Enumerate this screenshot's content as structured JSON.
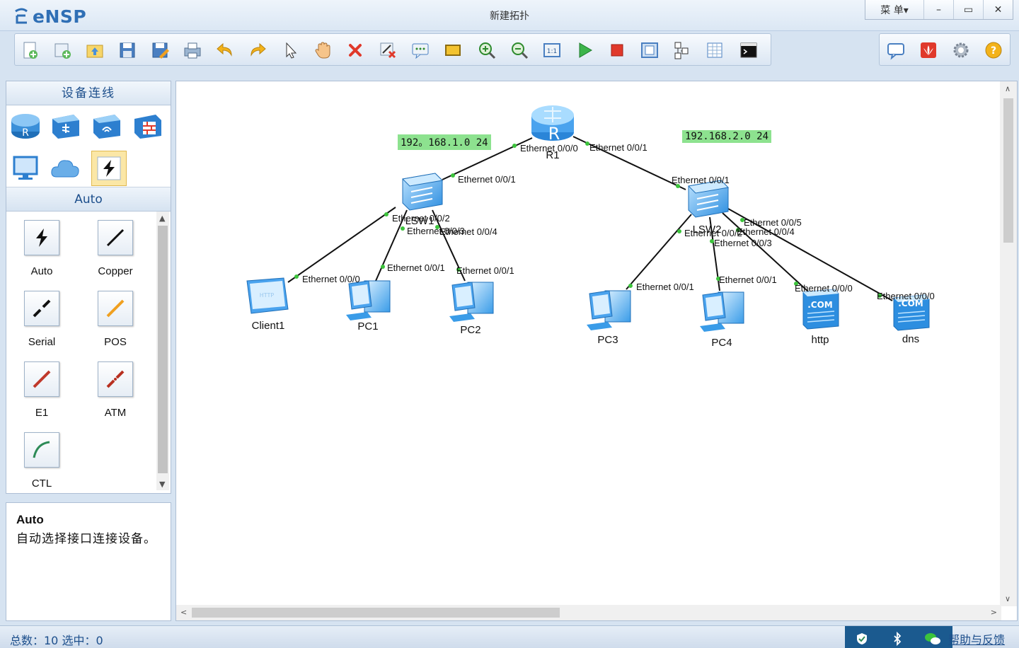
{
  "app": {
    "name": "eNSP",
    "window_title": "新建拓扑"
  },
  "window_controls": {
    "menu_label": "菜 单▾",
    "minimize": "–",
    "maximize": "▭",
    "close": "✕"
  },
  "toolbar": {
    "icons": [
      "new-topology-icon",
      "new-example-icon",
      "open-icon",
      "save-icon",
      "save-as-icon",
      "print-icon",
      "undo-icon",
      "redo-icon",
      "select-pointer-icon",
      "pan-hand-icon",
      "delete-icon",
      "delete-link-icon",
      "text-annotation-icon",
      "rectangle-icon",
      "zoom-in-icon",
      "zoom-out-icon",
      "fit-view-icon",
      "start-device-icon",
      "stop-device-icon",
      "capture-icon",
      "topology-icon",
      "grid-icon",
      "console-icon"
    ],
    "right_icons": [
      "chat-icon",
      "huawei-icon",
      "settings-gear-icon",
      "help-icon"
    ]
  },
  "left_panel": {
    "device_header": "设备连线",
    "devices": [
      "router-icon",
      "switch-icon",
      "wlan-icon",
      "firewall-icon",
      "pc-icon",
      "cloud-icon",
      "auto-link-icon"
    ],
    "cable_header": "Auto",
    "cables": [
      {
        "label": "Auto",
        "color": "#111111"
      },
      {
        "label": "Copper",
        "color": "#111111"
      },
      {
        "label": "Serial",
        "color": "#111111"
      },
      {
        "label": "POS",
        "color": "#f0a020"
      },
      {
        "label": "E1",
        "color": "#c0392b"
      },
      {
        "label": "ATM",
        "color": "#b83020"
      },
      {
        "label": "CTL",
        "color": "#2e8b57"
      }
    ]
  },
  "description": {
    "title": "Auto",
    "text": "自动选择接口连接设备。"
  },
  "topology": {
    "ip_labels": [
      "192。168.1.0 24",
      "192.168.2.0 24"
    ],
    "devices": [
      {
        "name": "R1",
        "type": "router"
      },
      {
        "name": "LSW1",
        "type": "switch"
      },
      {
        "name": "LSW2",
        "type": "switch"
      },
      {
        "name": "Client1",
        "type": "client"
      },
      {
        "name": "PC1",
        "type": "pc"
      },
      {
        "name": "PC2",
        "type": "pc"
      },
      {
        "name": "PC3",
        "type": "pc"
      },
      {
        "name": "PC4",
        "type": "pc"
      },
      {
        "name": "http",
        "type": "server"
      },
      {
        "name": "dns",
        "type": "server"
      }
    ],
    "port_labels": [
      "Ethernet 0/0/0",
      "Ethernet 0/0/1",
      "Ethernet 0/0/1",
      "Ethernet 0/0/1",
      "Ethernet 0/0/2",
      "Ethernet 0/0/3",
      "Ethernet 0/0/4",
      "Ethernet 0/0/0",
      "Ethernet 0/0/1",
      "Ethernet 0/0/1",
      "Ethernet 0/0/2",
      "Ethernet 0/0/5",
      "Ethernet 0/0/4",
      "Ethernet 0/0/3",
      "Ethernet 0/0/1",
      "Ethernet 0/0/1",
      "Ethernet 0/0/0",
      "Ethernet 0/0/0"
    ]
  },
  "status": {
    "text": "总数：10  选中：0",
    "help": "帮助与反馈"
  },
  "colors": {
    "link_dot": "#3cc43c",
    "ip_bg": "#8de28f",
    "accent": "#1d4f8c"
  }
}
